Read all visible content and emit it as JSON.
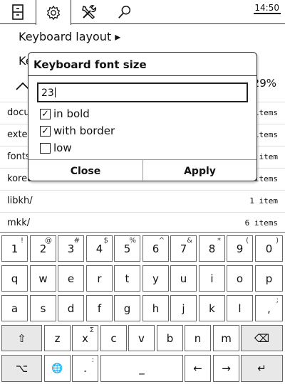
{
  "toolbar": {
    "icons": [
      "cabinet-icon",
      "gear-icon",
      "tools-icon",
      "search-icon"
    ],
    "clock": "14:50"
  },
  "menu": {
    "keyboard_layout": "Keyboard layout ▸",
    "row2_fragment": "Ke"
  },
  "progress_text": "29%",
  "files": [
    {
      "name": "docu",
      "count": "items"
    },
    {
      "name": "exter",
      "count": "items"
    },
    {
      "name": "fonts",
      "count": "item"
    },
    {
      "name": "korea",
      "count": "items"
    },
    {
      "name": "libkh/",
      "count": "1 item"
    },
    {
      "name": "mkk/",
      "count": "6 items"
    }
  ],
  "dialog": {
    "title": "Keyboard font size",
    "input_value": "23",
    "options": [
      {
        "label": "in bold",
        "checked": true
      },
      {
        "label": "with border",
        "checked": true
      },
      {
        "label": "low",
        "checked": false
      }
    ],
    "close_label": "Close",
    "apply_label": "Apply"
  },
  "keyboard": {
    "row1": [
      {
        "k": "1",
        "a": "!"
      },
      {
        "k": "2",
        "a": "@"
      },
      {
        "k": "3",
        "a": "#"
      },
      {
        "k": "4",
        "a": "$"
      },
      {
        "k": "5",
        "a": "%"
      },
      {
        "k": "6",
        "a": "^"
      },
      {
        "k": "7",
        "a": "&"
      },
      {
        "k": "8",
        "a": "*"
      },
      {
        "k": "9",
        "a": "("
      },
      {
        "k": "0",
        "a": ")"
      }
    ],
    "row2": [
      "q",
      "w",
      "e",
      "r",
      "t",
      "y",
      "u",
      "i",
      "o",
      "p"
    ],
    "row3": [
      "a",
      "s",
      "d",
      "f",
      "g",
      "h",
      "j",
      "k",
      "l",
      ","
    ],
    "row3_alt_last": ";",
    "row4_letters": [
      "z",
      "x",
      "c",
      "v",
      "b",
      "n",
      "m"
    ],
    "x_alt": "Σ",
    "shift_glyph": "⇧",
    "backspace_glyph": "⌫",
    "row5": {
      "sym": "⌥",
      "globe": "🌐",
      "dot": ".",
      "dot_alt": ":",
      "space": "_",
      "left": "←",
      "right": "→",
      "enter": "↵"
    }
  }
}
